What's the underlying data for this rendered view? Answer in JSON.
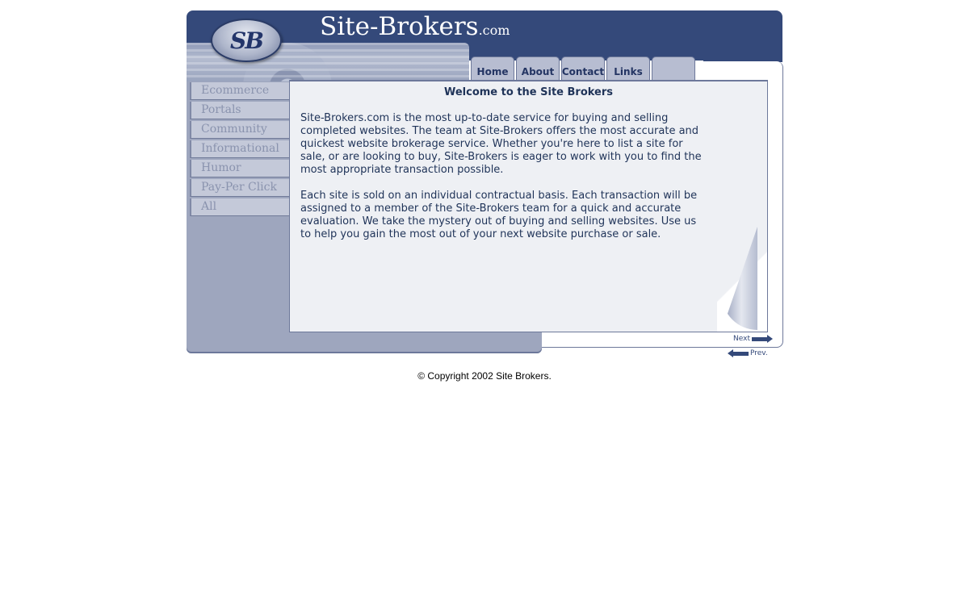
{
  "header": {
    "logo_text": "SB",
    "site_name": "Site-Brokers",
    "site_suffix": ".com"
  },
  "tabs": [
    {
      "label": "Home"
    },
    {
      "label": "About"
    },
    {
      "label": "Contact"
    },
    {
      "label": "Links"
    },
    {
      "label": ""
    }
  ],
  "sidebar": {
    "categories": [
      {
        "label": "Ecommerce"
      },
      {
        "label": "Portals"
      },
      {
        "label": "Community"
      },
      {
        "label": "Informational"
      },
      {
        "label": "Humor"
      },
      {
        "label": "Pay-Per Click"
      },
      {
        "label": "All"
      }
    ]
  },
  "main": {
    "title": "Welcome to the Site Brokers",
    "paragraph1": "Site-Brokers.com is the most up-to-date service for buying and selling completed websites.  The team at Site-Brokers offers the most accurate and quickest website brokerage service.  Whether you're here to list a site for sale, or are looking to buy, Site-Brokers is eager to work with you to find the most appropriate transaction possible.",
    "paragraph2": "Each site is sold on an individual contractual basis.  Each transaction will be assigned to a member of the Site-Brokers team for a quick and accurate evaluation.  We take the mystery out of buying and selling websites.  Use us to help you gain the most out of your next website purchase or sale."
  },
  "pager": {
    "next_label": "Next",
    "prev_label": "Prev."
  },
  "footer": {
    "copyright": "© Copyright 2002 Site Brokers."
  },
  "colors": {
    "header_blue": "#34497a",
    "sidebar_gray": "#9ea6be",
    "panel_bg": "#eef0f4",
    "text_navy": "#1f3358"
  }
}
